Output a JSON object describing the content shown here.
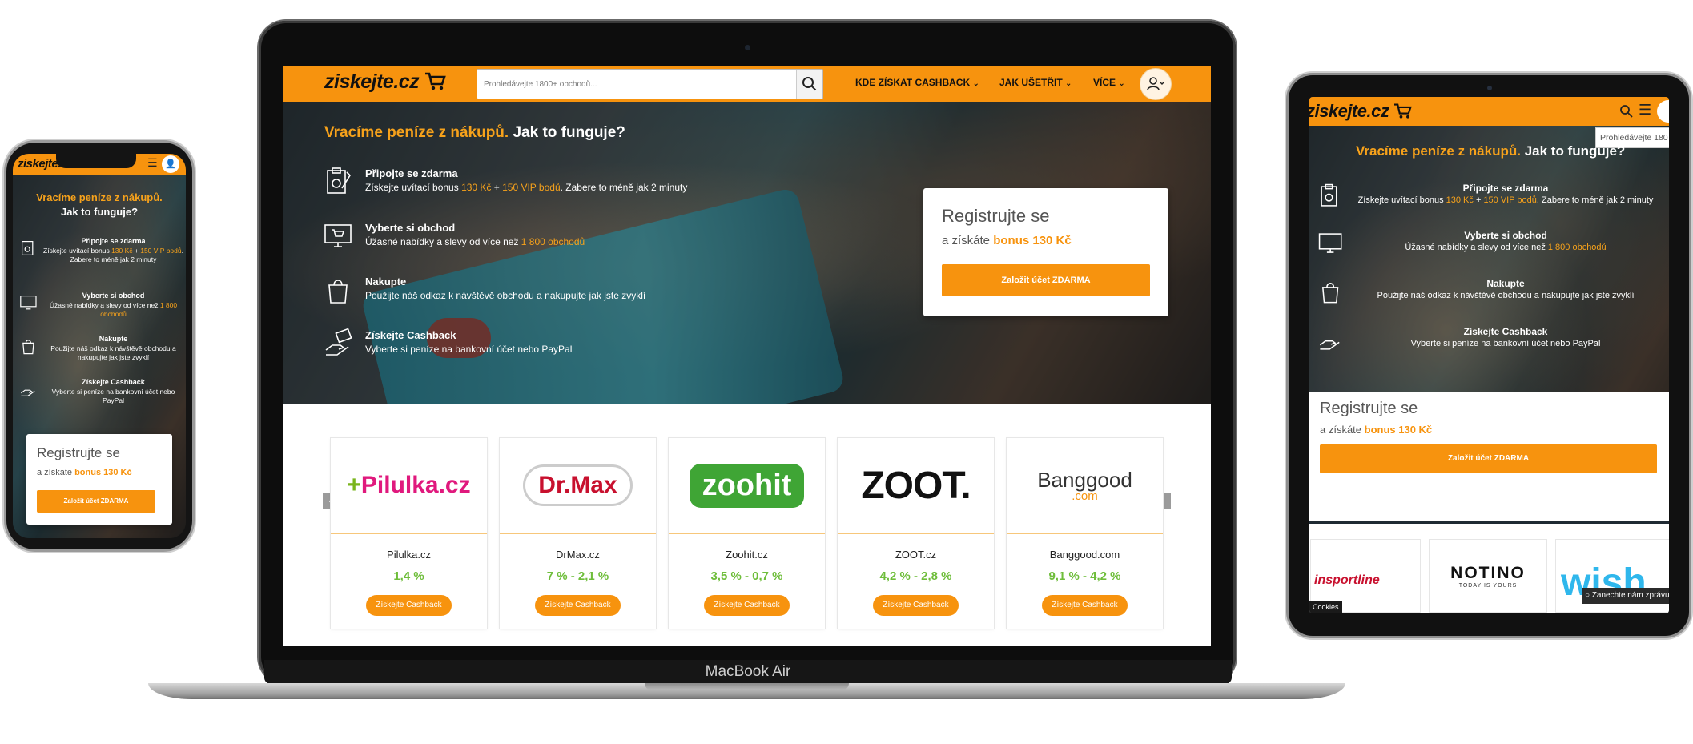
{
  "laptop": {
    "brand_label": "MacBook Air",
    "search": {
      "placeholder": "Prohledávejte 1800+ obchodů..."
    },
    "nav": [
      {
        "label": "KDE ZÍSKAT CASHBACK"
      },
      {
        "label": "JAK UŠETŘIT"
      },
      {
        "label": "VÍCE"
      }
    ],
    "hero": {
      "headline_orange": "Vracíme peníze z nákupů.",
      "headline_white": "Jak to funguje?",
      "steps": [
        {
          "title": "Připojte se zdarma",
          "text_before": "Získejte uvítací bonus ",
          "highlight1": "130 Kč",
          "mid": " + ",
          "highlight2": "150 VIP bodů",
          "text_after": ". Zabere to méně jak 2 minuty",
          "icon": "clipboard-icon"
        },
        {
          "title": "Vyberte si obchod",
          "text_before": "Úžasné nabídky a slevy od více než ",
          "highlight1": "1 800 obchodů",
          "mid": "",
          "highlight2": "",
          "text_after": "",
          "icon": "monitor-cart-icon"
        },
        {
          "title": "Nakupte",
          "text_before": "Použijte náš odkaz k návštěvě obchodu a nakupujte jak jste zvyklí",
          "highlight1": "",
          "mid": "",
          "highlight2": "",
          "text_after": "",
          "icon": "shopping-bag-icon"
        },
        {
          "title": "Získejte Cashback",
          "text_before": "Vyberte si peníze na bankovní účet nebo PayPal",
          "highlight1": "",
          "mid": "",
          "highlight2": "",
          "text_after": "",
          "icon": "hand-money-icon"
        }
      ]
    },
    "register": {
      "title": "Registrujte se",
      "sub_prefix": "a získáte ",
      "sub_bonus": "bonus 130 Kč",
      "button": "Založit účet ZDARMA"
    },
    "shops": [
      {
        "name": "Pilulka.cz",
        "rate": "1,4 %",
        "button": "Získejte Cashback",
        "logo": "pilulka"
      },
      {
        "name": "DrMax.cz",
        "rate": "7 % - 2,1 %",
        "button": "Získejte Cashback",
        "logo": "drmax"
      },
      {
        "name": "Zoohit.cz",
        "rate": "3,5 % - 0,7 %",
        "button": "Získejte Cashback",
        "logo": "zoohit"
      },
      {
        "name": "ZOOT.cz",
        "rate": "4,2 % - 2,8 %",
        "button": "Získejte Cashback",
        "logo": "zoot"
      },
      {
        "name": "Banggood.com",
        "rate": "9,1 % - 4,2 %",
        "button": "Získejte Cashback",
        "logo": "banggood"
      }
    ],
    "shop_logo_text": {
      "pilulka": "Pilulka.cz",
      "drmax": "Dr.Max",
      "zoohit": "zoohit",
      "zoot": "ZOOT.",
      "banggood_top": "Banggood",
      "banggood_bottom": ".com"
    }
  },
  "logo": {
    "text": "ziskejte.cz"
  },
  "phone": {
    "headline_orange": "Vracíme peníze z nákupů.",
    "headline_white": "Jak to funguje?",
    "steps": [
      {
        "title": "Připojte se zdarma",
        "line1": "Získejte uvítací bonus ",
        "h1": "130 Kč",
        "mid": " + ",
        "h2": "150 VIP bodů",
        "after": ". Zabere to méně jak 2 minuty"
      },
      {
        "title": "Vyberte si obchod",
        "line1": "Úžasné nabídky a slevy od více než ",
        "h1": "1 800 obchodů",
        "mid": "",
        "h2": "",
        "after": ""
      },
      {
        "title": "Nakupte",
        "line1": "Použijte náš odkaz k návštěvě obchodu a nakupujte jak jste zvyklí",
        "h1": "",
        "mid": "",
        "h2": "",
        "after": ""
      },
      {
        "title": "Získejte Cashback",
        "line1": "Vyberte si peníze na bankovní účet nebo PayPal",
        "h1": "",
        "mid": "",
        "h2": "",
        "after": ""
      }
    ],
    "register": {
      "title": "Registrujte se",
      "sub_prefix": "a získáte ",
      "sub_bonus": "bonus 130 Kč",
      "button": "Založit účet ZDARMA"
    }
  },
  "tablet": {
    "search_popup": "Prohledávejte 180",
    "headline_orange": "Vracíme peníze z nákupů.",
    "headline_white": "Jak to funguje?",
    "steps": [
      {
        "title": "Připojte se zdarma",
        "line1": "Získejte uvítací bonus ",
        "h1": "130 Kč",
        "mid": " + ",
        "h2": "150 VIP bodů",
        "after": ". Zabere to méně jak 2 minuty"
      },
      {
        "title": "Vyberte si obchod",
        "line1": "Úžasné nabídky a slevy od více než ",
        "h1": "1 800 obchodů",
        "mid": "",
        "h2": "",
        "after": ""
      },
      {
        "title": "Nakupte",
        "line1": "Použijte náš odkaz k návštěvě obchodu a nakupujte jak jste zvyklí",
        "h1": "",
        "mid": "",
        "h2": "",
        "after": ""
      },
      {
        "title": "Získejte Cashback",
        "line1": "Vyberte si peníze na bankovní účet nebo PayPal",
        "h1": "",
        "mid": "",
        "h2": "",
        "after": ""
      }
    ],
    "register": {
      "title": "Registrujte se",
      "sub_prefix": "a získáte ",
      "sub_bonus": "bonus 130 Kč",
      "button": "Založit účet ZDARMA"
    },
    "shop_logos": {
      "insportline": "insportline",
      "notino": "NOTINO",
      "notino_tag": "TODAY IS YOURS",
      "wish": "wish"
    },
    "cookies_label": "Cookies",
    "message_label": "Zanechte nám zprávu"
  },
  "colors": {
    "brand_orange": "#f7930e",
    "accent_orange": "#f7a21b",
    "rate_green": "#6ebd3a"
  }
}
